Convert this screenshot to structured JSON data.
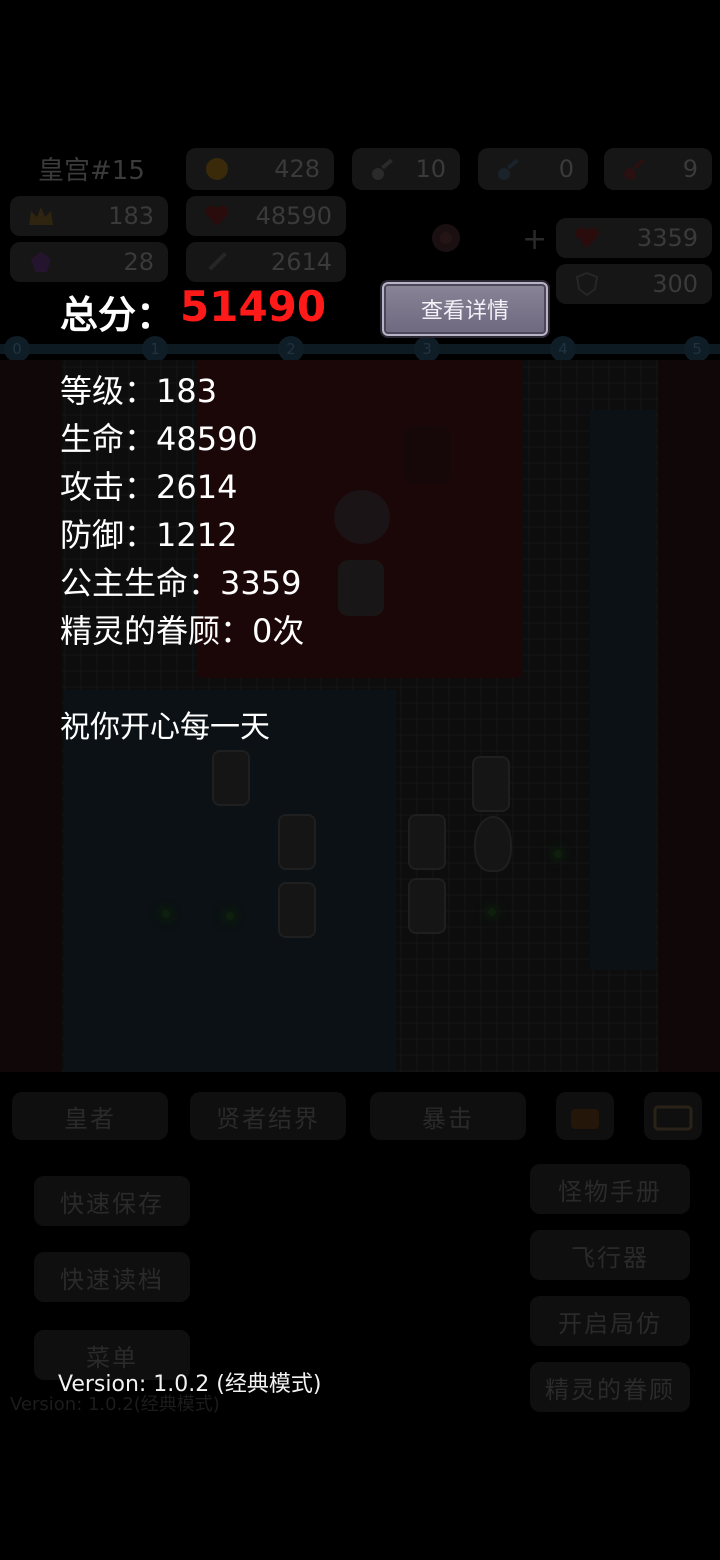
{
  "background": {
    "hud": {
      "title": "皇宫#15",
      "coins": "428",
      "key_yellow": "10",
      "key_blue": "0",
      "key_red": "9",
      "level": "183",
      "hp": "48590",
      "gems": "28",
      "attack": "2614",
      "princess_hp": "3359",
      "defense": "300"
    },
    "track_nodes": [
      "0",
      "1",
      "2",
      "3",
      "4",
      "5"
    ],
    "skill_buttons": [
      "皇者",
      "贤者结界",
      "暴击"
    ],
    "left_buttons": [
      "快速保存",
      "快速读档",
      "菜单"
    ],
    "right_buttons": [
      "怪物手册",
      "飞行器",
      "开启局仿",
      "精灵的眷顾"
    ],
    "version_text": "Version: 1.0.2(经典模式)"
  },
  "dialog": {
    "score_label": "总分：",
    "score_value": "51490",
    "details_button": "查看详情",
    "stats": [
      "等级：183",
      "生命：48590",
      "攻击：2614",
      "防御：1212",
      "公主生命：3359",
      "精灵的眷顾：0次"
    ],
    "blessing": "祝你开心每一天",
    "version": "Version: 1.0.2 (经典模式)"
  },
  "colors": {
    "score_value": "#ff1a1a",
    "text": "#ffffff",
    "button_bg": "#7c768c"
  }
}
